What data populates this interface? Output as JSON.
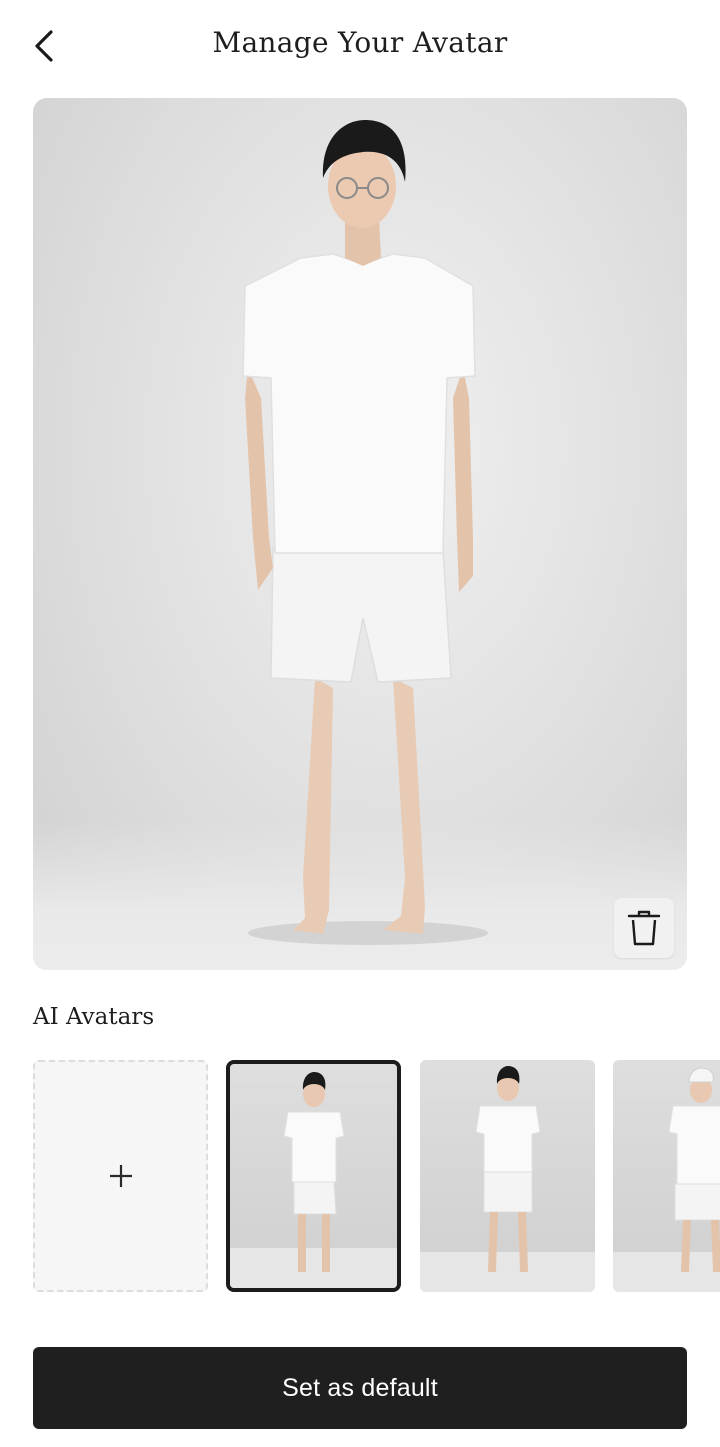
{
  "header": {
    "title": "Manage Your Avatar",
    "back_icon": "chevron-left-icon"
  },
  "preview": {
    "image_desc_icon": "avatar-full-body-image",
    "delete_icon": "trash-icon"
  },
  "ai_avatars": {
    "label": "AI Avatars",
    "add_icon": "plus-icon",
    "items": [
      {
        "icon": "avatar-thumbnail-image",
        "selected": true
      },
      {
        "icon": "avatar-thumbnail-image",
        "selected": false
      },
      {
        "icon": "avatar-thumbnail-image",
        "selected": false
      }
    ]
  },
  "actions": {
    "primary_label": "Set as default"
  },
  "colors": {
    "primary_button": "#1f1f1f",
    "background": "#ffffff",
    "thumb_selected_border": "#1c1c1c"
  }
}
